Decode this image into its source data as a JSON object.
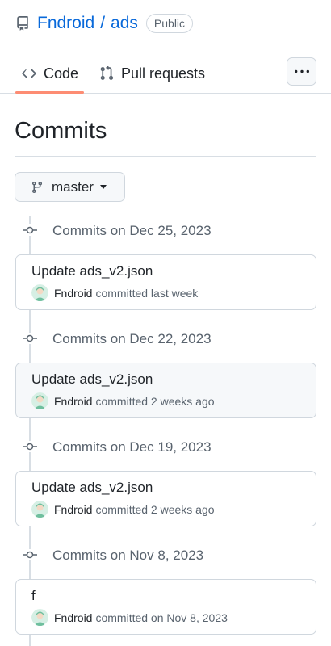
{
  "repo": {
    "owner": "Fndroid",
    "separator": "/",
    "name": "ads",
    "visibility": "Public"
  },
  "tabs": [
    {
      "label": "Code",
      "icon": "code-icon",
      "selected": true
    },
    {
      "label": "Pull requests",
      "icon": "git-pull-request-icon",
      "selected": false
    }
  ],
  "more_icon": "kebab-horizontal-icon",
  "page_title": "Commits",
  "branch": {
    "name": "master",
    "icon": "git-branch-icon"
  },
  "groups": [
    {
      "header": "Commits on Dec 25, 2023",
      "commit": {
        "message": "Update ads_v2.json",
        "author": "Fndroid",
        "when": "committed last week"
      }
    },
    {
      "header": "Commits on Dec 22, 2023",
      "commit": {
        "message": "Update ads_v2.json",
        "author": "Fndroid",
        "when": "committed 2 weeks ago"
      }
    },
    {
      "header": "Commits on Dec 19, 2023",
      "commit": {
        "message": "Update ads_v2.json",
        "author": "Fndroid",
        "when": "committed 2 weeks ago"
      }
    },
    {
      "header": "Commits on Nov 8, 2023",
      "commit": {
        "message": "f",
        "author": "Fndroid",
        "when": "committed on Nov 8, 2023"
      }
    }
  ],
  "colors": {
    "link": "#0969da",
    "muted": "#59636e",
    "tab_underline": "#fd8c73",
    "border": "#d0d7de"
  }
}
